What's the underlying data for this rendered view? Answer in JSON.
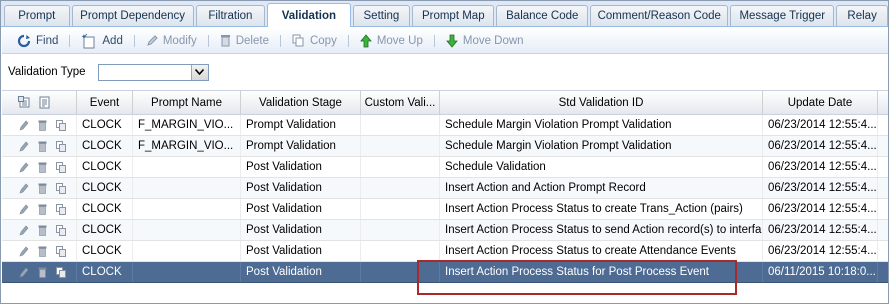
{
  "tabs": [
    {
      "label": "Prompt",
      "active": false,
      "w": 66
    },
    {
      "label": "Prompt Dependency",
      "active": false,
      "w": 122
    },
    {
      "label": "Filtration",
      "active": false,
      "w": 70
    },
    {
      "label": "Validation",
      "active": true,
      "w": 84
    },
    {
      "label": "Setting",
      "active": false,
      "w": 58
    },
    {
      "label": "Prompt Map",
      "active": false,
      "w": 82
    },
    {
      "label": "Balance Code",
      "active": false,
      "w": 92
    },
    {
      "label": "Comment/Reason Code",
      "active": false,
      "w": 138
    },
    {
      "label": "Message Trigger",
      "active": false,
      "w": 104
    },
    {
      "label": "Relay",
      "active": false,
      "w": 52
    }
  ],
  "toolbar": {
    "find": "Find",
    "add": "Add",
    "modify": "Modify",
    "delete": "Delete",
    "copy": "Copy",
    "move_up": "Move Up",
    "move_down": "Move Down"
  },
  "filter": {
    "label": "Validation Type",
    "value": ""
  },
  "columns": [
    "Event",
    "Prompt Name",
    "Validation Stage",
    "Custom Vali...",
    "Std Validation ID",
    "Update Date"
  ],
  "rows": [
    {
      "event": "CLOCK",
      "prompt": "F_MARGIN_VIO...",
      "stage": "Prompt Validation",
      "custom": "",
      "std": "Schedule Margin Violation Prompt Validation",
      "date": "06/23/2014 12:55:4..."
    },
    {
      "event": "CLOCK",
      "prompt": "F_MARGIN_VIO...",
      "stage": "Prompt Validation",
      "custom": "",
      "std": "Schedule Margin Violation Prompt Validation",
      "date": "06/23/2014 12:55:4..."
    },
    {
      "event": "CLOCK",
      "prompt": "",
      "stage": "Post Validation",
      "custom": "",
      "std": "Schedule Validation",
      "date": "06/23/2014 12:55:4..."
    },
    {
      "event": "CLOCK",
      "prompt": "",
      "stage": "Post Validation",
      "custom": "",
      "std": "Insert Action and Action Prompt Record",
      "date": "06/23/2014 12:55:4..."
    },
    {
      "event": "CLOCK",
      "prompt": "",
      "stage": "Post Validation",
      "custom": "",
      "std": "Insert Action Process Status to create Trans_Action (pairs)",
      "date": "06/23/2014 12:55:4..."
    },
    {
      "event": "CLOCK",
      "prompt": "",
      "stage": "Post Validation",
      "custom": "",
      "std": "Insert Action Process Status to send Action record(s) to interfa...",
      "date": "06/23/2014 12:55:4..."
    },
    {
      "event": "CLOCK",
      "prompt": "",
      "stage": "Post Validation",
      "custom": "",
      "std": "Insert Action Process Status to create Attendance Events",
      "date": "06/23/2014 12:55:4..."
    },
    {
      "event": "CLOCK",
      "prompt": "",
      "stage": "Post Validation",
      "custom": "",
      "std": "Insert Action Process Status for Post Process Event",
      "date": "06/11/2015 10:18:0...",
      "selected": true
    }
  ],
  "colors": {
    "selected_row": "#4d6b93",
    "highlight_box": "#a82a2a",
    "move_up_arrow": "#2e9e2e",
    "move_down_arrow": "#2e9e2e"
  }
}
